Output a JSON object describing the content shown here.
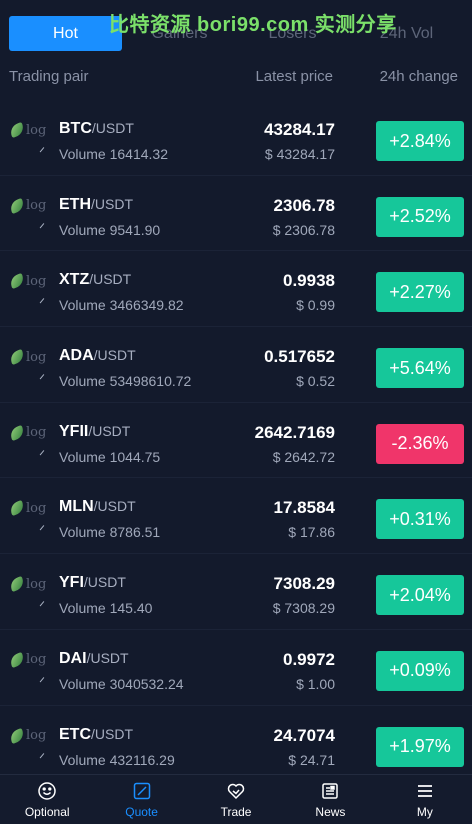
{
  "colors": {
    "background": "#131a2c",
    "accent": "#1a8fff",
    "up": "#16c79a",
    "down": "#f0356a"
  },
  "watermark": "比特资源 bori99.com 实测分享",
  "tabs": [
    {
      "label": "Hot",
      "active": true
    },
    {
      "label": "Gainers",
      "active": false
    },
    {
      "label": "Losers",
      "active": false
    },
    {
      "label": "24h Vol",
      "active": false
    }
  ],
  "columns": {
    "pair": "Trading pair",
    "price": "Latest price",
    "change": "24h change"
  },
  "logo_alt": "log",
  "rows": [
    {
      "base": "BTC",
      "quote": "/USDT",
      "volume": "Volume 16414.32",
      "price": "43284.17",
      "fiat": "$ 43284.17",
      "change": "+2.84%",
      "direction": "up"
    },
    {
      "base": "ETH",
      "quote": "/USDT",
      "volume": "Volume 9541.90",
      "price": "2306.78",
      "fiat": "$ 2306.78",
      "change": "+2.52%",
      "direction": "up"
    },
    {
      "base": "XTZ",
      "quote": "/USDT",
      "volume": "Volume 3466349.82",
      "price": "0.9938",
      "fiat": "$ 0.99",
      "change": "+2.27%",
      "direction": "up"
    },
    {
      "base": "ADA",
      "quote": "/USDT",
      "volume": "Volume 53498610.72",
      "price": "0.517652",
      "fiat": "$ 0.52",
      "change": "+5.64%",
      "direction": "up"
    },
    {
      "base": "YFII",
      "quote": "/USDT",
      "volume": "Volume 1044.75",
      "price": "2642.7169",
      "fiat": "$ 2642.72",
      "change": "-2.36%",
      "direction": "down"
    },
    {
      "base": "MLN",
      "quote": "/USDT",
      "volume": "Volume 8786.51",
      "price": "17.8584",
      "fiat": "$ 17.86",
      "change": "+0.31%",
      "direction": "up"
    },
    {
      "base": "YFI",
      "quote": "/USDT",
      "volume": "Volume 145.40",
      "price": "7308.29",
      "fiat": "$ 7308.29",
      "change": "+2.04%",
      "direction": "up"
    },
    {
      "base": "DAI",
      "quote": "/USDT",
      "volume": "Volume 3040532.24",
      "price": "0.9972",
      "fiat": "$ 1.00",
      "change": "+0.09%",
      "direction": "up"
    },
    {
      "base": "ETC",
      "quote": "/USDT",
      "volume": "Volume 432116.29",
      "price": "24.7074",
      "fiat": "$ 24.71",
      "change": "+1.97%",
      "direction": "up"
    }
  ],
  "nav": [
    {
      "label": "Optional",
      "icon": "smiley-icon",
      "active": false
    },
    {
      "label": "Quote",
      "icon": "quote-icon",
      "active": true
    },
    {
      "label": "Trade",
      "icon": "trade-icon",
      "active": false
    },
    {
      "label": "News",
      "icon": "news-icon",
      "active": false
    },
    {
      "label": "My",
      "icon": "menu-icon",
      "active": false
    }
  ]
}
